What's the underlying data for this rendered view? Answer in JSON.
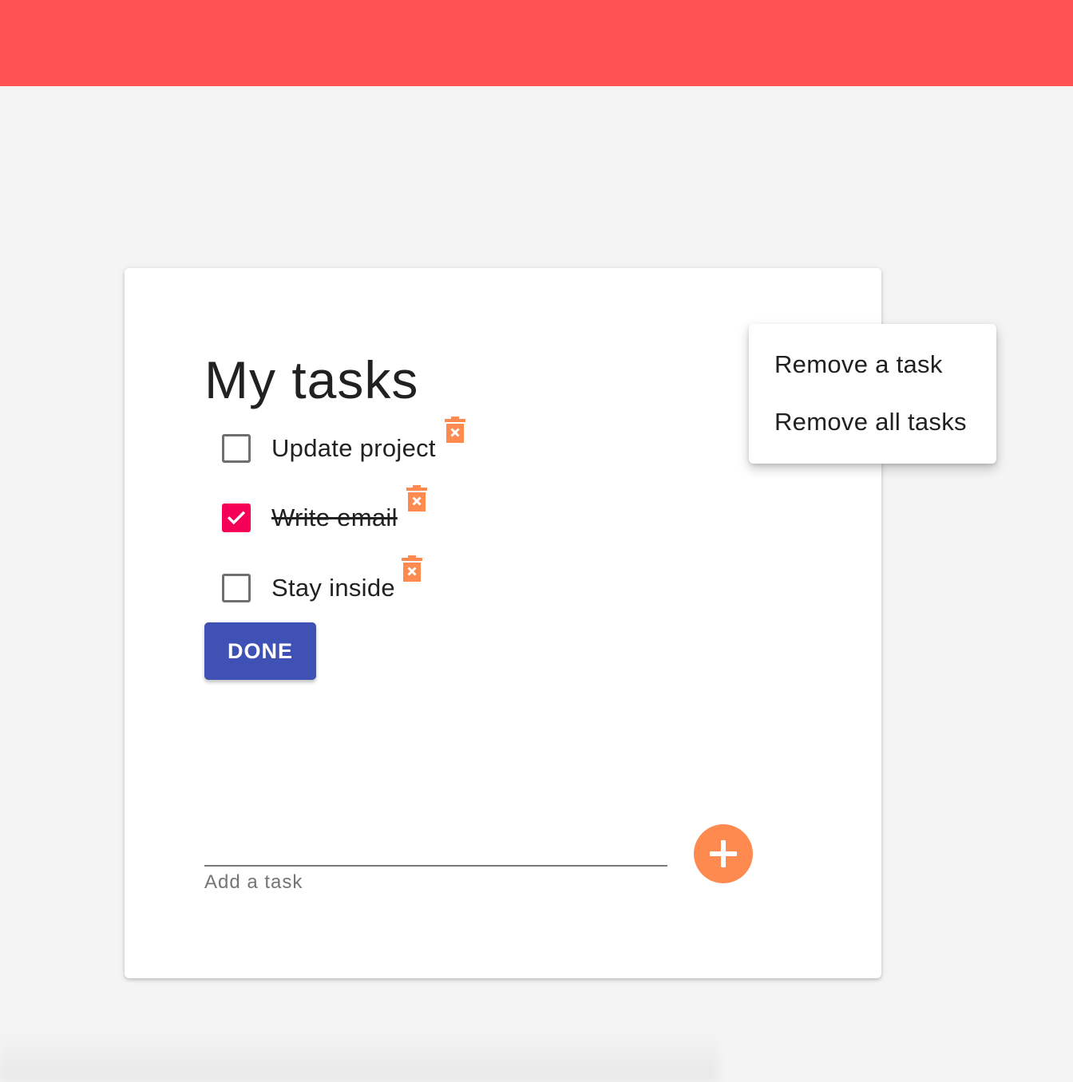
{
  "page": {
    "title": "My tasks"
  },
  "tasks": [
    {
      "label": "Update project",
      "checked": false
    },
    {
      "label": "Write email",
      "checked": true
    },
    {
      "label": "Stay inside",
      "checked": false
    }
  ],
  "done_button": {
    "label": "DONE"
  },
  "add_task": {
    "helper": "Add a task",
    "value": ""
  },
  "menu": {
    "items": [
      {
        "label": "Remove a task"
      },
      {
        "label": "Remove all tasks"
      }
    ]
  },
  "colors": {
    "topbar": "#ff5252",
    "checkbox_checked": "#f50057",
    "done_button": "#3f51b5",
    "fab": "#ff8a50",
    "trash_icon": "#ff8a50"
  },
  "icons": {
    "trash": "delete-forever-icon",
    "add": "plus-icon",
    "check": "check-icon"
  }
}
